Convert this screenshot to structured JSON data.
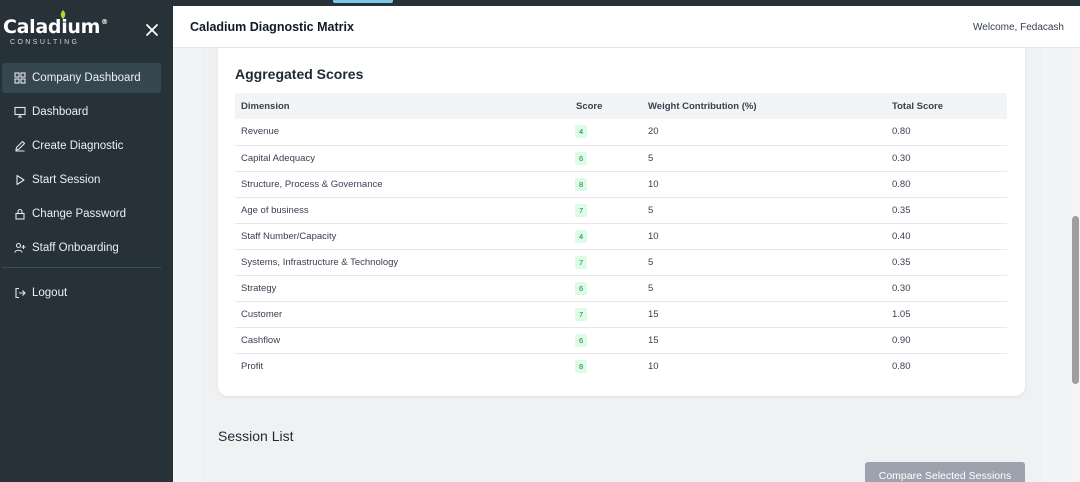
{
  "app": {
    "logo_text": "Caladium",
    "logo_reg": "®",
    "logo_sub": "CONSULTING",
    "title": "Caladium Diagnostic Matrix",
    "welcome": "Welcome, Fedacash"
  },
  "sidebar": {
    "items": [
      {
        "label": "Company Dashboard",
        "icon": "grid-icon",
        "active": true
      },
      {
        "label": "Dashboard",
        "icon": "monitor-icon"
      },
      {
        "label": "Create Diagnostic",
        "icon": "pencil-icon"
      },
      {
        "label": "Start Session",
        "icon": "play-icon"
      },
      {
        "label": "Change Password",
        "icon": "lock-icon"
      },
      {
        "label": "Staff Onboarding",
        "icon": "user-plus-icon"
      }
    ],
    "logout": {
      "label": "Logout",
      "icon": "logout-icon"
    }
  },
  "aggregated": {
    "title": "Aggregated Scores",
    "headers": {
      "dimension": "Dimension",
      "score": "Score",
      "weight": "Weight Contribution (%)",
      "total": "Total Score"
    },
    "rows": [
      {
        "dimension": "Revenue",
        "score": "4",
        "weight": "20",
        "total": "0.80"
      },
      {
        "dimension": "Capital Adequacy",
        "score": "6",
        "weight": "5",
        "total": "0.30"
      },
      {
        "dimension": "Structure, Process & Governance",
        "score": "8",
        "weight": "10",
        "total": "0.80"
      },
      {
        "dimension": "Age of business",
        "score": "7",
        "weight": "5",
        "total": "0.35"
      },
      {
        "dimension": "Staff Number/Capacity",
        "score": "4",
        "weight": "10",
        "total": "0.40"
      },
      {
        "dimension": "Systems, Infrastructure & Technology",
        "score": "7",
        "weight": "5",
        "total": "0.35"
      },
      {
        "dimension": "Strategy",
        "score": "6",
        "weight": "5",
        "total": "0.30"
      },
      {
        "dimension": "Customer",
        "score": "7",
        "weight": "15",
        "total": "1.05"
      },
      {
        "dimension": "Cashflow",
        "score": "6",
        "weight": "15",
        "total": "0.90"
      },
      {
        "dimension": "Profit",
        "score": "8",
        "weight": "10",
        "total": "0.80"
      }
    ]
  },
  "session": {
    "title": "Session List",
    "compare_label": "Compare Selected Sessions"
  },
  "colors": {
    "sidebar_bg": "#263238",
    "badge_bg": "#dcfce7",
    "badge_text": "#15803d",
    "button_disabled": "#9ca3af",
    "logo_leaf": "#b8d433"
  }
}
